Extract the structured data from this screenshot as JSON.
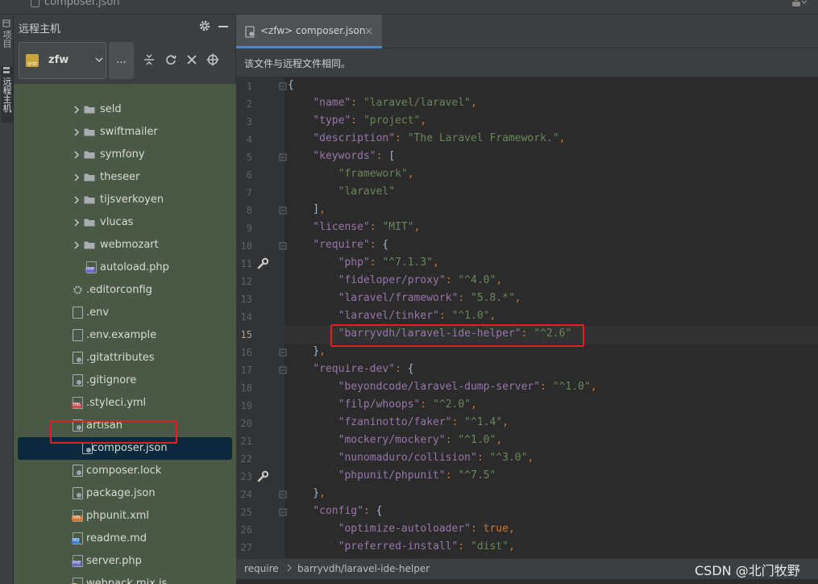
{
  "topbar": {
    "file": "composer.json"
  },
  "toolstrip": {
    "tabs": [
      "项目",
      "远程主机"
    ]
  },
  "panel": {
    "title": "远程主机",
    "server": {
      "name": "zfw",
      "icon_tag": "SFTP"
    },
    "more_label": "..."
  },
  "tree": {
    "items": [
      {
        "label": "seld",
        "kind": "folder"
      },
      {
        "label": "swiftmailer",
        "kind": "folder"
      },
      {
        "label": "symfony",
        "kind": "folder"
      },
      {
        "label": "theseer",
        "kind": "folder"
      },
      {
        "label": "tijsverkoyen",
        "kind": "folder"
      },
      {
        "label": "vlucas",
        "kind": "folder"
      },
      {
        "label": "webmozart",
        "kind": "folder"
      },
      {
        "label": "autoload.php",
        "kind": "php"
      },
      {
        "label": ".editorconfig",
        "kind": "config"
      },
      {
        "label": ".env",
        "kind": "text"
      },
      {
        "label": ".env.example",
        "kind": "text"
      },
      {
        "label": ".gitattributes",
        "kind": "git"
      },
      {
        "label": ".gitignore",
        "kind": "git"
      },
      {
        "label": ".styleci.yml",
        "kind": "yml"
      },
      {
        "label": "artisan",
        "kind": "git"
      },
      {
        "label": "composer.json",
        "kind": "json",
        "selected": true
      },
      {
        "label": "composer.lock",
        "kind": "json"
      },
      {
        "label": "package.json",
        "kind": "json"
      },
      {
        "label": "phpunit.xml",
        "kind": "xml"
      },
      {
        "label": "readme.md",
        "kind": "md"
      },
      {
        "label": "server.php",
        "kind": "php"
      },
      {
        "label": "webpack.mix.js",
        "kind": "js"
      }
    ]
  },
  "editor": {
    "tab_label": "<zfw> composer.json",
    "notice": "该文件与远程文件相同。",
    "lines": [
      "{",
      "    \"name\": \"laravel/laravel\",",
      "    \"type\": \"project\",",
      "    \"description\": \"The Laravel Framework.\",",
      "    \"keywords\": [",
      "        \"framework\",",
      "        \"laravel\"",
      "    ],",
      "    \"license\": \"MIT\",",
      "    \"require\": {",
      "        \"php\": \"^7.1.3\",",
      "        \"fideloper/proxy\": \"^4.0\",",
      "        \"laravel/framework\": \"5.8.*\",",
      "        \"laravel/tinker\": \"^1.0\",",
      "        \"barryvdh/laravel-ide-helper\": \"^2.6\"",
      "    },",
      "    \"require-dev\": {",
      "        \"beyondcode/laravel-dump-server\": \"^1.0\",",
      "        \"filp/whoops\": \"^2.0\",",
      "        \"fzaninotto/faker\": \"^1.4\",",
      "        \"mockery/mockery\": \"^1.0\",",
      "        \"nunomaduro/collision\": \"^3.0\",",
      "        \"phpunit/phpunit\": \"^7.5\"",
      "    },",
      "    \"config\": {",
      "        \"optimize-autoloader\": true,",
      "        \"preferred-install\": \"dist\","
    ],
    "current_line": 15
  },
  "statusbar": {
    "crumbs": [
      "require",
      "barryvdh/laravel-ide-helper"
    ]
  },
  "watermark": "CSDN @北门牧野",
  "colors": {
    "accent": "#4a88c7",
    "highlight_box": "#e02020",
    "tree_bg": "#4a5945",
    "selected_row": "#0d293e"
  }
}
